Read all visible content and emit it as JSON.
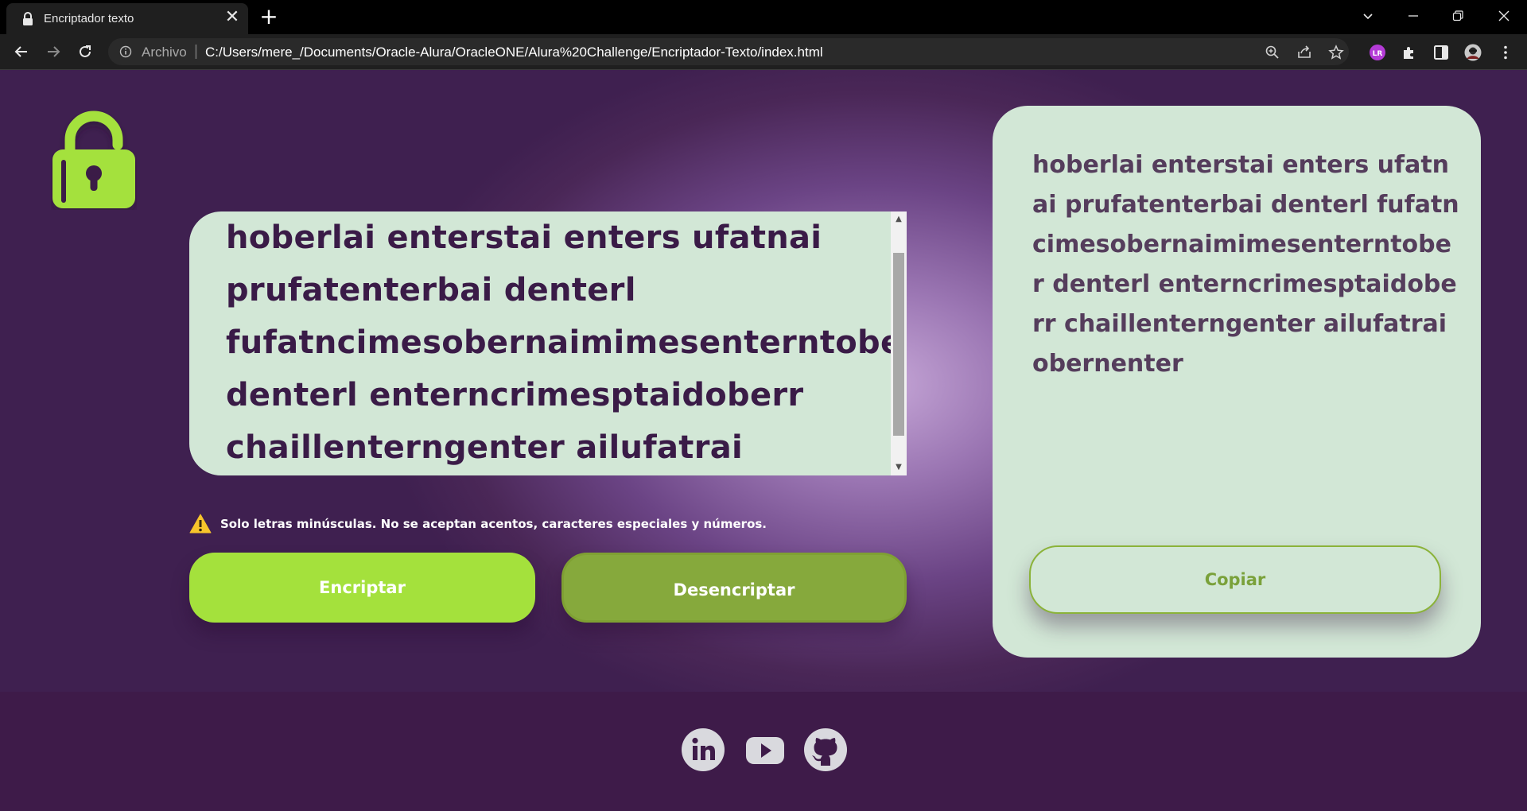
{
  "browser": {
    "tab_title": "Encriptador texto",
    "tab_close": "✕",
    "new_tab": "+",
    "scheme_label": "Archivo",
    "separator": "|",
    "url": "C:/Users/mere_/Documents/Oracle-Alura/OracleONE/Alura%20Challenge/Encriptador-Texto/index.html",
    "window_controls": [
      "⌄",
      "—",
      "❐",
      "✕"
    ]
  },
  "main": {
    "input_text": "hoberlai enterstai enters ufatnai prufatenterbai denterl fufatncimesobernaimimesenterntober denterl enterncrimesptaidoberr chaillenterngenter ailufatrai obernenter",
    "warning_text": "Solo letras minúsculas. No se aceptan acentos, caracteres especiales y números.",
    "encrypt_label": "Encriptar",
    "decrypt_label": "Desencriptar"
  },
  "output": {
    "text": "hoberlai enterstai enters ufatnai prufatenterbai denterl fufatncimesobernaimimesenterntober denterl enterncrimesptaidoberr chaillenterngenter ailufatrai obernenter",
    "copy_label": "Copiar"
  },
  "footer": {
    "icons": [
      "linkedin-icon",
      "youtube-icon",
      "github-icon"
    ]
  },
  "colors": {
    "accent_green": "#a4e13c",
    "dark_green": "#86a93c",
    "panel": "#d2e7d6",
    "text_purple": "#3a1b47",
    "footer_bg": "#3e1b49"
  }
}
